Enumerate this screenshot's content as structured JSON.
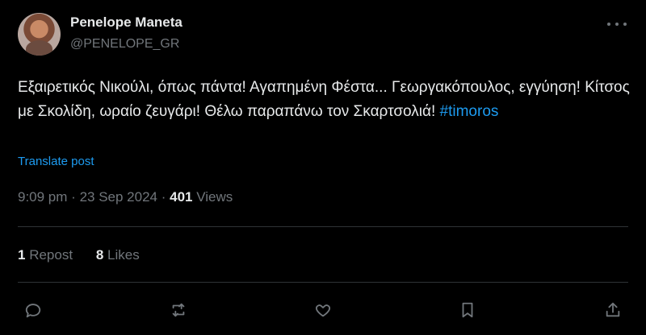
{
  "user": {
    "display_name": "Penelope Maneta",
    "handle": "@PENELOPE_GR"
  },
  "post": {
    "text": "Εξαιρετικός Νικούλι, όπως πάντα! Αγαπημένη Φέστα... Γεωργακόπουλος, εγγύηση! Κίτσος με Σκολίδη, ωραίο ζευγάρι! Θέλω παραπάνω τον Σκαρτσολιά!",
    "hashtag": "#timoros",
    "translate_label": "Translate post"
  },
  "meta": {
    "time": "9:09 pm",
    "separator": "·",
    "date": "23 Sep 2024",
    "views_count": "401",
    "views_label": "Views"
  },
  "stats": {
    "reposts_count": "1",
    "reposts_label": "Repost",
    "likes_count": "8",
    "likes_label": "Likes"
  },
  "actions": [
    "reply-icon",
    "repost-icon",
    "like-icon",
    "bookmark-icon",
    "share-icon"
  ],
  "colors": {
    "background": "#000000",
    "text": "#e7e9ea",
    "muted": "#71767b",
    "accent": "#1d9bf0",
    "divider": "#2f3336"
  }
}
